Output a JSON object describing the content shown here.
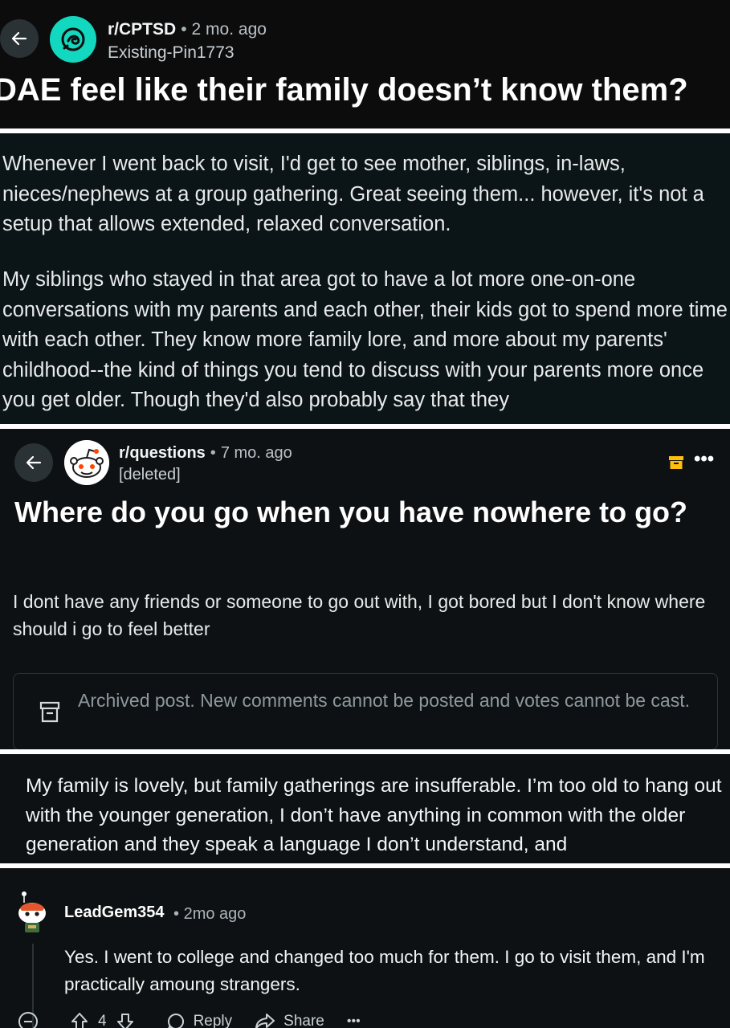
{
  "colors": {
    "panel_bg": "#0b1416",
    "accent_teal": "#12d8c0",
    "archive_yellow": "#ffbf0b",
    "text_primary": "#f2f4f5",
    "text_muted": "#8d989d"
  },
  "post1": {
    "subreddit": "r/CPTSD",
    "separator": "•",
    "time": "2 mo. ago",
    "username": "Existing-Pin1773",
    "title": "DAE feel like their family doesn’t know them?",
    "icons": [
      "back-arrow-icon",
      "cptsd-community-icon"
    ]
  },
  "post1_body": {
    "paragraph1": "Whenever I went back to visit, I'd get to see mother, siblings, in-laws, nieces/nephews at a group gathering. Great seeing them... however, it's not a setup that allows extended, relaxed conversation.",
    "paragraph2": "My siblings who stayed in that area got to have a lot more one-on-one conversations with my parents and each other, their kids got to spend more time with each other. They know more family lore, and more about my parents' childhood--the kind of things you tend to discuss with your parents more once you get older. Though they'd also probably say that they"
  },
  "post2": {
    "subreddit": "r/questions",
    "separator": "•",
    "time": "7 mo. ago",
    "username": "[deleted]",
    "title": "Where do you go when you have nowhere to go?",
    "body": "I dont have any friends or someone to go out with, I got bored but I don't know where should i go to feel better",
    "notice": "Archived post. New comments cannot be posted and votes cannot be cast.",
    "more_label": "•••",
    "icons": [
      "back-arrow-icon",
      "snoo-avatar-icon",
      "archive-icon",
      "more-icon"
    ]
  },
  "comment_excerpt": {
    "text": "My family is lovely, but family gatherings are insufferable. I’m too old to hang out with the younger generation, I don’t have anything in common with the older generation and they speak a language I don’t understand, and"
  },
  "comment": {
    "username": "LeadGem354",
    "separator": "•",
    "time": "2mo ago",
    "text": "Yes. I went to college and changed too much for them. I go to visit them, and I'm practically amoung strangers.",
    "vote_count": "4",
    "reply_label": "Reply",
    "share_label": "Share",
    "more_label": "•••"
  }
}
